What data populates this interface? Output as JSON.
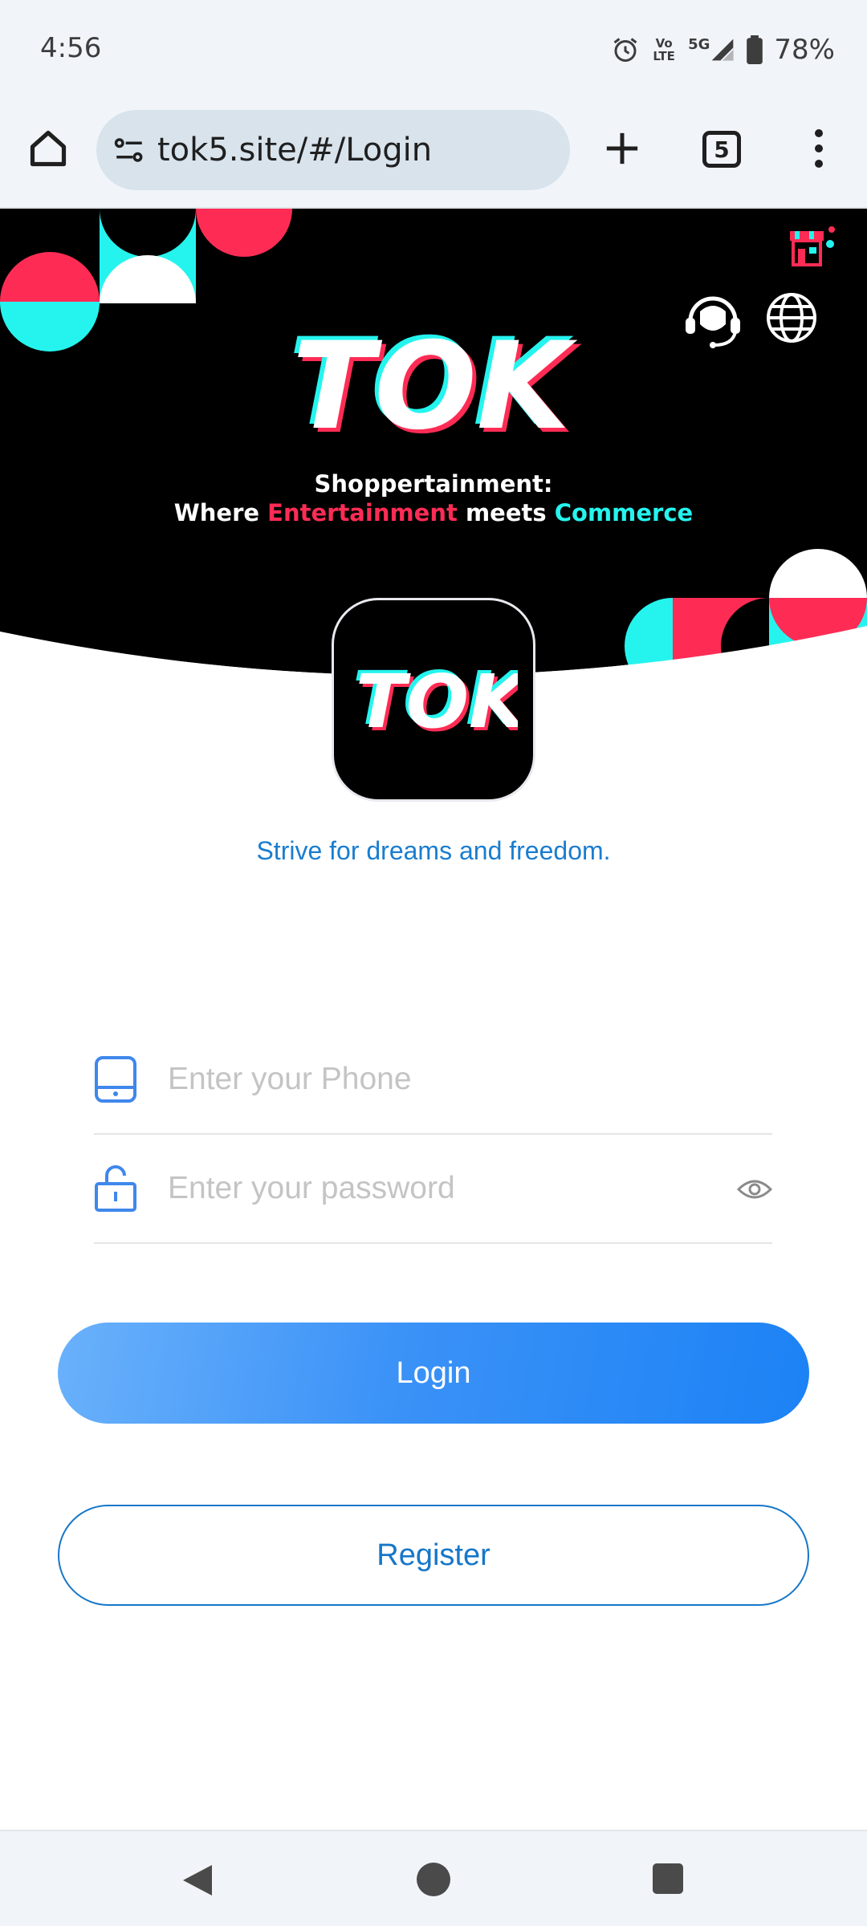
{
  "status_bar": {
    "time": "4:56",
    "network_volte": "Vo LTE",
    "network_type": "5G",
    "battery": "78%"
  },
  "browser": {
    "url": "tok5.site/#/Login",
    "tab_count": "5"
  },
  "hero": {
    "brand": "TOK",
    "tagline_line1": "Shoppertainment:",
    "tagline_where": "Where ",
    "tagline_entertainment": "Entertainment",
    "tagline_meets": " meets ",
    "tagline_commerce": "Commerce"
  },
  "slogan": "Strive for dreams and freedom.",
  "form": {
    "phone_placeholder": "Enter your Phone",
    "password_placeholder": "Enter your password",
    "login_label": "Login",
    "register_label": "Register"
  },
  "colors": {
    "tiktok_pink": "#fe2c55",
    "tiktok_cyan": "#25f4ee",
    "primary_blue": "#1c82f5",
    "slogan_blue": "#1a7dcf"
  },
  "icons": [
    "home-icon",
    "site-settings-icon",
    "plus-icon",
    "tabs-icon",
    "more-vert-icon",
    "shop-icon",
    "customer-support-icon",
    "globe-icon",
    "phone-icon",
    "lock-icon",
    "eye-icon",
    "back-nav-icon",
    "home-nav-icon",
    "recents-nav-icon"
  ]
}
